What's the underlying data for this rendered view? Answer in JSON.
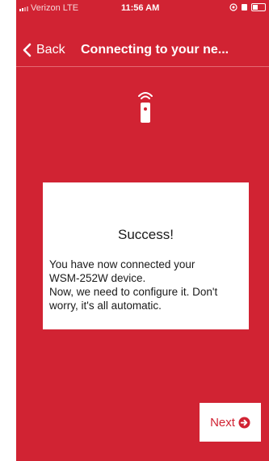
{
  "status_bar": {
    "carrier": "Verizon  LTE",
    "time": "11:56 AM"
  },
  "nav": {
    "back_label": "Back",
    "title": "Connecting to your ne..."
  },
  "card": {
    "title": "Success!",
    "message_lines": [
      "You have now connected your",
      "WSM-252W device.",
      "Now, we need to configure it. Don't",
      "worry, it's all automatic."
    ]
  },
  "next_button": {
    "label": "Next"
  },
  "colors": {
    "background": "#d12333",
    "card": "#ffffff",
    "text_on_card": "#1a1a1a"
  },
  "icons": [
    "signal-icon",
    "battery-icon",
    "back-chevron-icon",
    "remote-wifi-icon",
    "arrow-circle-right-icon"
  ]
}
